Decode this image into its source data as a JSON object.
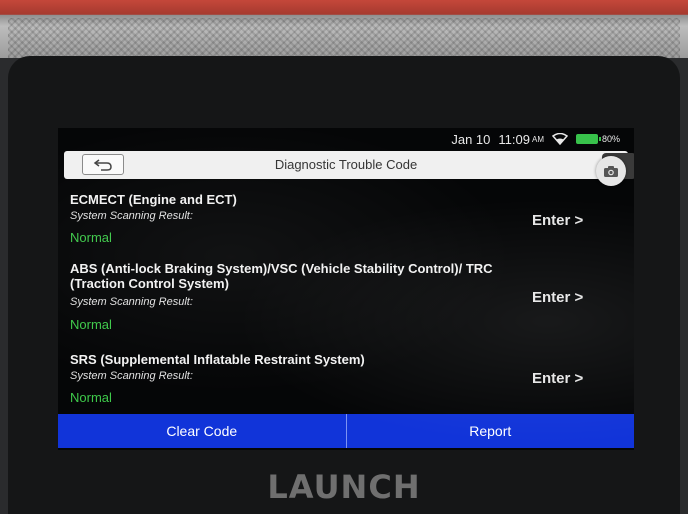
{
  "status_bar": {
    "date": "Jan 10",
    "time": "11:09",
    "ampm": "AM",
    "battery": "80%"
  },
  "header": {
    "title": "Diagnostic Trouble Code"
  },
  "systems": [
    {
      "name": "ECMECT (Engine and ECT)",
      "scan_label": "System Scanning Result:",
      "result": "Normal",
      "action": "Enter >"
    },
    {
      "name": "ABS (Anti-lock Braking System)/VSC (Vehicle Stability Control)/ TRC (Traction Control System)",
      "scan_label": "System Scanning Result:",
      "result": "Normal",
      "action": "Enter >"
    },
    {
      "name": "SRS (Supplemental Inflatable Restraint System)",
      "scan_label": "System Scanning Result:",
      "result": "Normal",
      "action": "Enter >"
    }
  ],
  "footer": {
    "clear_code_label": "Clear Code",
    "report_label": "Report"
  },
  "brand": "LAUNCH",
  "colors": {
    "result_normal": "#3ec94a",
    "footer_bg": "#1134d9",
    "device_accent": "#c4473a"
  },
  "icons": [
    "back-arrow-icon",
    "camera-icon",
    "wifi-icon",
    "battery-icon"
  ]
}
